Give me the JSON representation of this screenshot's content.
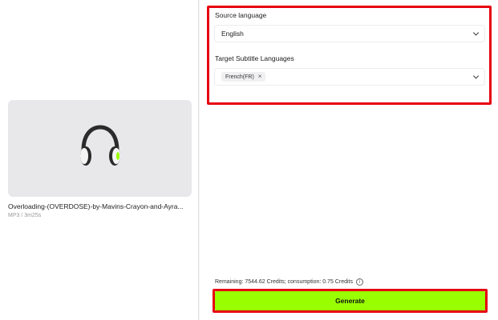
{
  "media": {
    "file_name": "Overloading-(OVERDOSE)-by-Mavins-Crayon-and-Ayra...",
    "file_meta": "MP3 / 3m25s",
    "thumbnail_icon": "headphones-icon"
  },
  "settings": {
    "source_label": "Source language",
    "source_value": "English",
    "target_label": "Target Subtitle Languages",
    "target_chips": [
      "French(FR)"
    ]
  },
  "footer": {
    "credits_text": "Remaining: 7544.62 Credits; consumption: 0.75 Credits",
    "generate_label": "Generate"
  },
  "colors": {
    "accent": "#99ff00",
    "highlight": "#e60012"
  }
}
